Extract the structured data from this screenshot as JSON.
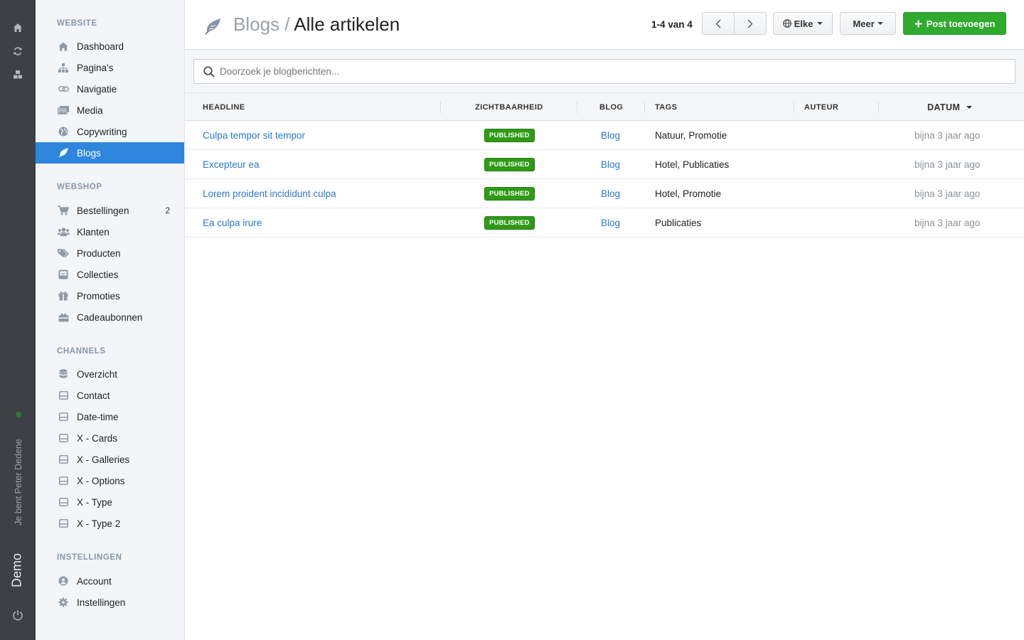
{
  "rail": {
    "user": "Je bent Peter Dedene",
    "app": "Demo"
  },
  "sidebar": {
    "website_heading": "WEBSITE",
    "website_items": [
      {
        "label": "Dashboard",
        "icon": "home-icon"
      },
      {
        "label": "Pagina's",
        "icon": "sitemap-icon"
      },
      {
        "label": "Navigatie",
        "icon": "link-icon"
      },
      {
        "label": "Media",
        "icon": "images-icon"
      },
      {
        "label": "Copywriting",
        "icon": "globe-icon"
      },
      {
        "label": "Blogs",
        "icon": "feather-icon",
        "active": true
      }
    ],
    "webshop_heading": "WEBSHOP",
    "webshop_items": [
      {
        "label": "Bestellingen",
        "icon": "cart-icon",
        "badge": "2"
      },
      {
        "label": "Klanten",
        "icon": "users-icon"
      },
      {
        "label": "Producten",
        "icon": "tags-icon"
      },
      {
        "label": "Collecties",
        "icon": "inbox-icon"
      },
      {
        "label": "Promoties",
        "icon": "gift-icon"
      },
      {
        "label": "Cadeaubonnen",
        "icon": "gift-card-icon"
      }
    ],
    "channels_heading": "CHANNELS",
    "channels_items": [
      {
        "label": "Overzicht",
        "icon": "database-icon"
      },
      {
        "label": "Contact",
        "icon": "form-icon"
      },
      {
        "label": "Date-time",
        "icon": "form-icon"
      },
      {
        "label": "X - Cards",
        "icon": "form-icon"
      },
      {
        "label": "X - Galleries",
        "icon": "form-icon"
      },
      {
        "label": "X - Options",
        "icon": "form-icon"
      },
      {
        "label": "X - Type",
        "icon": "form-icon"
      },
      {
        "label": "X - Type 2",
        "icon": "form-icon"
      }
    ],
    "settings_heading": "INSTELLINGEN",
    "settings_items": [
      {
        "label": "Account",
        "icon": "user-circle-icon"
      },
      {
        "label": "Instellingen",
        "icon": "gear-icon"
      }
    ]
  },
  "header": {
    "crumb": "Blogs",
    "separator": " / ",
    "title": "Alle artikelen",
    "pager": "1-4 van 4",
    "elke_label": "Elke",
    "meer_label": "Meer",
    "add_label": "Post toevoegen"
  },
  "search": {
    "placeholder": "Doorzoek je blogberichten..."
  },
  "table": {
    "columns": [
      "HEADLINE",
      "ZICHTBAARHEID",
      "BLOG",
      "TAGS",
      "AUTEUR",
      "DATUM"
    ],
    "rows": [
      {
        "headline": "Culpa tempor sit tempor",
        "status": "PUBLISHED",
        "blog": "Blog",
        "tags": "Natuur, Promotie",
        "author": "",
        "date": "bijna 3 jaar ago"
      },
      {
        "headline": "Excepteur ea",
        "status": "PUBLISHED",
        "blog": "Blog",
        "tags": "Hotel, Publicaties",
        "author": "",
        "date": "bijna 3 jaar ago"
      },
      {
        "headline": "Lorem proident incididunt culpa",
        "status": "PUBLISHED",
        "blog": "Blog",
        "tags": "Hotel, Promotie",
        "author": "",
        "date": "bijna 3 jaar ago"
      },
      {
        "headline": "Ea culpa irure",
        "status": "PUBLISHED",
        "blog": "Blog",
        "tags": "Publicaties",
        "author": "",
        "date": "bijna 3 jaar ago"
      }
    ]
  },
  "colors": {
    "accent": "#2d86dc",
    "primary_button": "#2faa2f",
    "published": "#2e9a16",
    "link": "#2a78c8",
    "rail": "#3d4147"
  }
}
